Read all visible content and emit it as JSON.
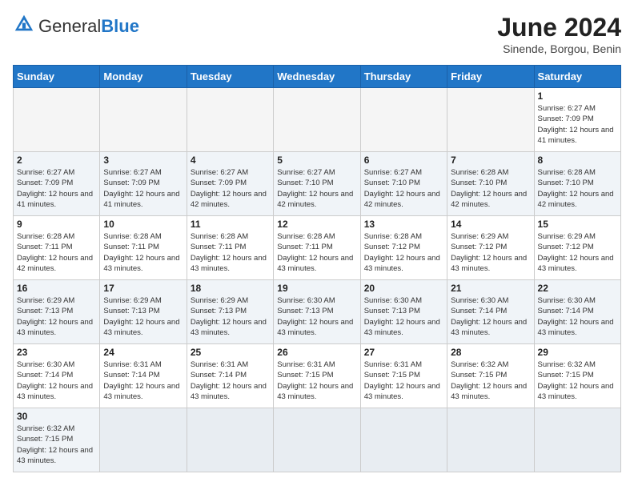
{
  "header": {
    "logo_general": "General",
    "logo_blue": "Blue",
    "month_title": "June 2024",
    "location": "Sinende, Borgou, Benin"
  },
  "weekdays": [
    "Sunday",
    "Monday",
    "Tuesday",
    "Wednesday",
    "Thursday",
    "Friday",
    "Saturday"
  ],
  "weeks": [
    [
      {
        "day": "",
        "info": ""
      },
      {
        "day": "",
        "info": ""
      },
      {
        "day": "",
        "info": ""
      },
      {
        "day": "",
        "info": ""
      },
      {
        "day": "",
        "info": ""
      },
      {
        "day": "",
        "info": ""
      },
      {
        "day": "1",
        "info": "Sunrise: 6:27 AM\nSunset: 7:09 PM\nDaylight: 12 hours and 41 minutes."
      }
    ],
    [
      {
        "day": "2",
        "info": "Sunrise: 6:27 AM\nSunset: 7:09 PM\nDaylight: 12 hours and 41 minutes."
      },
      {
        "day": "3",
        "info": "Sunrise: 6:27 AM\nSunset: 7:09 PM\nDaylight: 12 hours and 41 minutes."
      },
      {
        "day": "4",
        "info": "Sunrise: 6:27 AM\nSunset: 7:09 PM\nDaylight: 12 hours and 42 minutes."
      },
      {
        "day": "5",
        "info": "Sunrise: 6:27 AM\nSunset: 7:10 PM\nDaylight: 12 hours and 42 minutes."
      },
      {
        "day": "6",
        "info": "Sunrise: 6:27 AM\nSunset: 7:10 PM\nDaylight: 12 hours and 42 minutes."
      },
      {
        "day": "7",
        "info": "Sunrise: 6:28 AM\nSunset: 7:10 PM\nDaylight: 12 hours and 42 minutes."
      },
      {
        "day": "8",
        "info": "Sunrise: 6:28 AM\nSunset: 7:10 PM\nDaylight: 12 hours and 42 minutes."
      }
    ],
    [
      {
        "day": "9",
        "info": "Sunrise: 6:28 AM\nSunset: 7:11 PM\nDaylight: 12 hours and 42 minutes."
      },
      {
        "day": "10",
        "info": "Sunrise: 6:28 AM\nSunset: 7:11 PM\nDaylight: 12 hours and 43 minutes."
      },
      {
        "day": "11",
        "info": "Sunrise: 6:28 AM\nSunset: 7:11 PM\nDaylight: 12 hours and 43 minutes."
      },
      {
        "day": "12",
        "info": "Sunrise: 6:28 AM\nSunset: 7:11 PM\nDaylight: 12 hours and 43 minutes."
      },
      {
        "day": "13",
        "info": "Sunrise: 6:28 AM\nSunset: 7:12 PM\nDaylight: 12 hours and 43 minutes."
      },
      {
        "day": "14",
        "info": "Sunrise: 6:29 AM\nSunset: 7:12 PM\nDaylight: 12 hours and 43 minutes."
      },
      {
        "day": "15",
        "info": "Sunrise: 6:29 AM\nSunset: 7:12 PM\nDaylight: 12 hours and 43 minutes."
      }
    ],
    [
      {
        "day": "16",
        "info": "Sunrise: 6:29 AM\nSunset: 7:13 PM\nDaylight: 12 hours and 43 minutes."
      },
      {
        "day": "17",
        "info": "Sunrise: 6:29 AM\nSunset: 7:13 PM\nDaylight: 12 hours and 43 minutes."
      },
      {
        "day": "18",
        "info": "Sunrise: 6:29 AM\nSunset: 7:13 PM\nDaylight: 12 hours and 43 minutes."
      },
      {
        "day": "19",
        "info": "Sunrise: 6:30 AM\nSunset: 7:13 PM\nDaylight: 12 hours and 43 minutes."
      },
      {
        "day": "20",
        "info": "Sunrise: 6:30 AM\nSunset: 7:13 PM\nDaylight: 12 hours and 43 minutes."
      },
      {
        "day": "21",
        "info": "Sunrise: 6:30 AM\nSunset: 7:14 PM\nDaylight: 12 hours and 43 minutes."
      },
      {
        "day": "22",
        "info": "Sunrise: 6:30 AM\nSunset: 7:14 PM\nDaylight: 12 hours and 43 minutes."
      }
    ],
    [
      {
        "day": "23",
        "info": "Sunrise: 6:30 AM\nSunset: 7:14 PM\nDaylight: 12 hours and 43 minutes."
      },
      {
        "day": "24",
        "info": "Sunrise: 6:31 AM\nSunset: 7:14 PM\nDaylight: 12 hours and 43 minutes."
      },
      {
        "day": "25",
        "info": "Sunrise: 6:31 AM\nSunset: 7:14 PM\nDaylight: 12 hours and 43 minutes."
      },
      {
        "day": "26",
        "info": "Sunrise: 6:31 AM\nSunset: 7:15 PM\nDaylight: 12 hours and 43 minutes."
      },
      {
        "day": "27",
        "info": "Sunrise: 6:31 AM\nSunset: 7:15 PM\nDaylight: 12 hours and 43 minutes."
      },
      {
        "day": "28",
        "info": "Sunrise: 6:32 AM\nSunset: 7:15 PM\nDaylight: 12 hours and 43 minutes."
      },
      {
        "day": "29",
        "info": "Sunrise: 6:32 AM\nSunset: 7:15 PM\nDaylight: 12 hours and 43 minutes."
      }
    ],
    [
      {
        "day": "30",
        "info": "Sunrise: 6:32 AM\nSunset: 7:15 PM\nDaylight: 12 hours and 43 minutes."
      },
      {
        "day": "",
        "info": ""
      },
      {
        "day": "",
        "info": ""
      },
      {
        "day": "",
        "info": ""
      },
      {
        "day": "",
        "info": ""
      },
      {
        "day": "",
        "info": ""
      },
      {
        "day": "",
        "info": ""
      }
    ]
  ]
}
